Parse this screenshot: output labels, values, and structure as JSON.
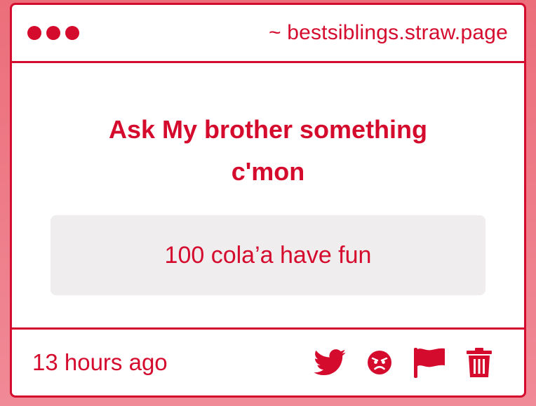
{
  "window": {
    "url": "~ bestsiblings.straw.page"
  },
  "question": {
    "text": "Ask My brother something c'mon"
  },
  "answer": {
    "text": "100 cola’a have fun"
  },
  "footer": {
    "timestamp": "13 hours ago",
    "icons": [
      "twitter-icon",
      "angry-face-icon",
      "flag-icon",
      "trash-icon"
    ]
  },
  "colors": {
    "accent": "#d50b2e",
    "answer_bg": "#efedee",
    "page_bg": "#ec6e7b"
  }
}
